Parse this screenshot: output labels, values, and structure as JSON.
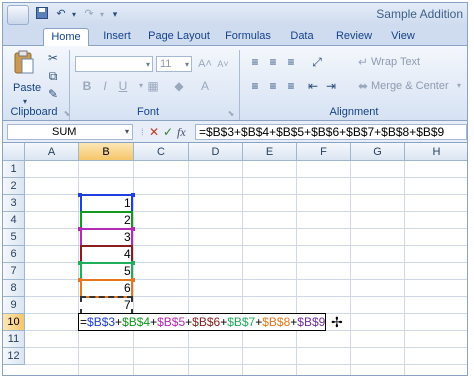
{
  "window": {
    "title": "Sample Addition"
  },
  "quick_access": {
    "save_icon": "save-icon",
    "undo_icon": "undo-icon",
    "redo_icon": "redo-icon",
    "customize_icon": "dropdown-icon"
  },
  "tabs": [
    {
      "label": "Home",
      "active": true
    },
    {
      "label": "Insert"
    },
    {
      "label": "Page Layout"
    },
    {
      "label": "Formulas"
    },
    {
      "label": "Data"
    },
    {
      "label": "Review"
    },
    {
      "label": "View"
    }
  ],
  "ribbon": {
    "clipboard": {
      "label": "Clipboard",
      "paste_label": "Paste"
    },
    "font": {
      "label": "Font",
      "font_name": "",
      "font_size": "11",
      "bold": "B",
      "italic": "I",
      "underline": "U"
    },
    "alignment": {
      "label": "Alignment",
      "wrap_text": "Wrap Text",
      "merge_center": "Merge & Center"
    }
  },
  "formula_bar": {
    "name_box": "SUM",
    "formula": "=$B$3+$B$4+$B$5+$B$6+$B$7+$B$8+$B$9",
    "cancel_symbol": "✕",
    "enter_symbol": "✓",
    "fx_symbol": "fx"
  },
  "grid": {
    "columns": [
      "A",
      "B",
      "C",
      "D",
      "E",
      "F",
      "G",
      "H"
    ],
    "selected_column": "B",
    "rows": [
      "1",
      "2",
      "3",
      "4",
      "5",
      "6",
      "7",
      "8",
      "9",
      "10",
      "11",
      "12"
    ],
    "selected_row": "10",
    "values_b": [
      {
        "row": "3",
        "value": "1"
      },
      {
        "row": "4",
        "value": "2"
      },
      {
        "row": "5",
        "value": "3"
      },
      {
        "row": "6",
        "value": "4"
      },
      {
        "row": "7",
        "value": "5"
      },
      {
        "row": "8",
        "value": "6"
      },
      {
        "row": "9",
        "value": "7"
      }
    ],
    "editing_cell": {
      "address": "B10",
      "parts": [
        {
          "text": "=",
          "color": "#000000"
        },
        {
          "text": "$B$3",
          "color": "#1f3fe0"
        },
        {
          "text": "+",
          "color": "#000000"
        },
        {
          "text": "$B$4",
          "color": "#119b1e"
        },
        {
          "text": "+",
          "color": "#000000"
        },
        {
          "text": "$B$5",
          "color": "#b42ab4"
        },
        {
          "text": "+",
          "color": "#000000"
        },
        {
          "text": "$B$6",
          "color": "#8a1d1d"
        },
        {
          "text": "+",
          "color": "#000000"
        },
        {
          "text": "$B$7",
          "color": "#1fae5a"
        },
        {
          "text": "+",
          "color": "#000000"
        },
        {
          "text": "$B$8",
          "color": "#e5781e"
        },
        {
          "text": "+",
          "color": "#000000"
        },
        {
          "text": "$B$9",
          "color": "#7030a0"
        }
      ]
    },
    "reference_colors": [
      "#1f3fe0",
      "#119b1e",
      "#b42ab4",
      "#8a1d1d",
      "#1fae5a",
      "#e5781e",
      "#7030a0"
    ]
  }
}
